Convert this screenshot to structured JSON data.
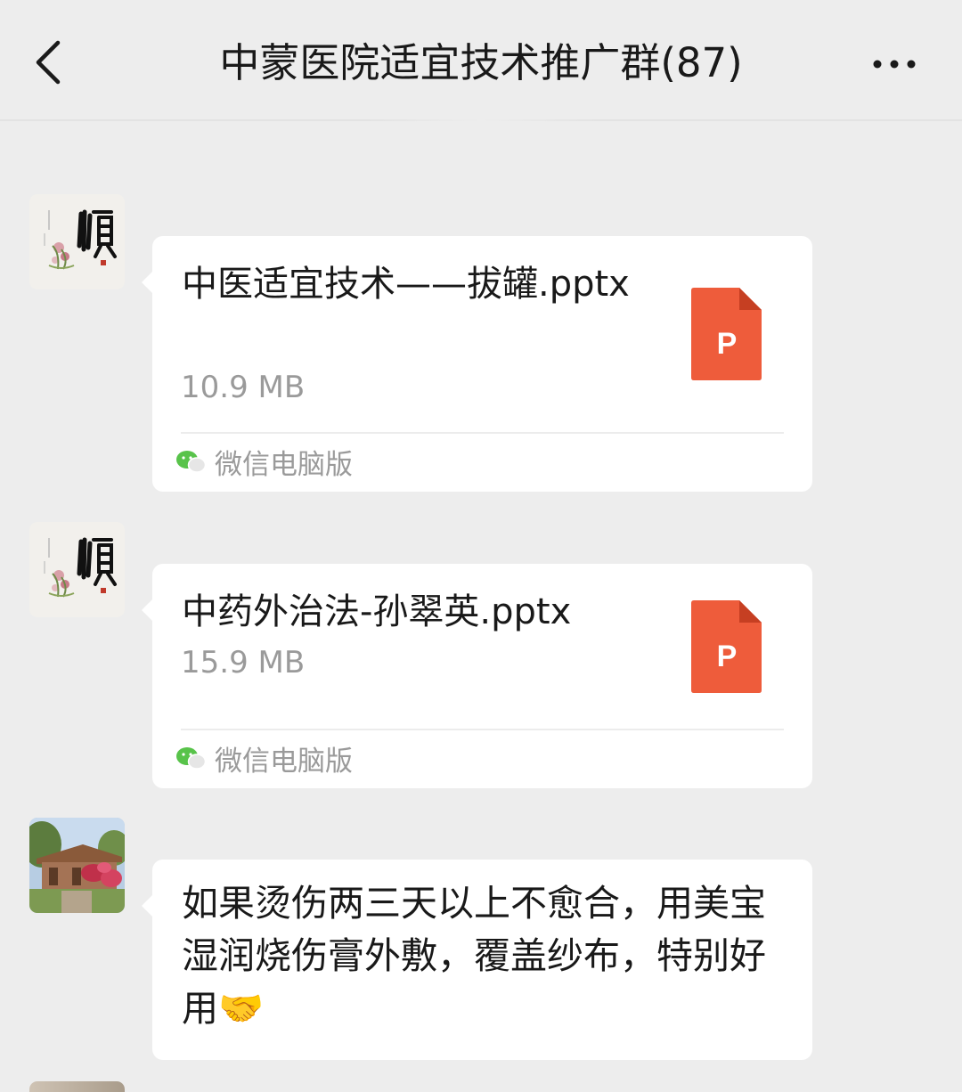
{
  "header": {
    "back_icon": "chevron-left-icon",
    "title": "中蒙医院适宜技术推广群(87)",
    "more_icon": "more-horizontal-icon"
  },
  "messages": [
    {
      "type": "file",
      "avatar": "calligraphy-shun-avatar",
      "file_name": "中医适宜技术——拔罐.pptx",
      "file_size": "10.9 MB",
      "file_icon_label": "P",
      "file_icon_color": "#ee5c3b",
      "source_icon": "wechat-icon",
      "source": "微信电脑版"
    },
    {
      "type": "file",
      "avatar": "calligraphy-shun-avatar",
      "file_name": "中药外治法-孙翠英.pptx",
      "file_size": "15.9 MB",
      "file_icon_label": "P",
      "file_icon_color": "#ee5c3b",
      "source_icon": "wechat-icon",
      "source": "微信电脑版"
    },
    {
      "type": "text",
      "avatar": "garden-house-avatar",
      "text": "如果烫伤两三天以上不愈合，用美宝湿润烧伤膏外敷，覆盖纱布，特别好用🤝"
    }
  ],
  "colors": {
    "background": "#ededed",
    "bubble": "#ffffff",
    "text": "#191919",
    "secondary_text": "#9a9a9a",
    "ppt_icon": "#ee5c3b",
    "wechat_green": "#58c34a"
  }
}
